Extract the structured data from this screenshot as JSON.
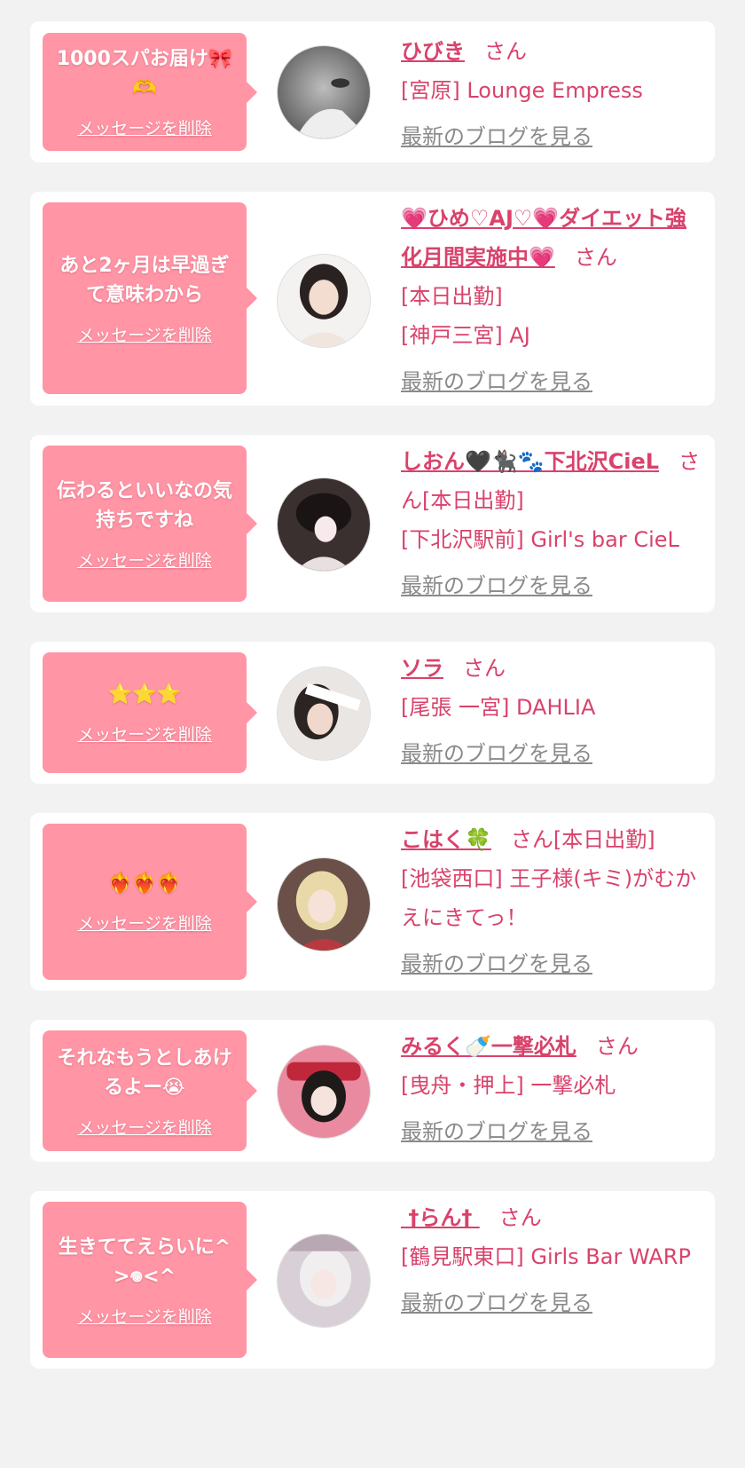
{
  "delete_label": "メッセージを削除",
  "blog_label": "最新のブログを見る",
  "san_label": "さん",
  "colors": {
    "background": "#f2f2f2",
    "bubble": "#ff95a5",
    "accent": "#d9426b",
    "link_gray": "#8a8a8a"
  },
  "cards": [
    {
      "message": "1000スパお届け🎀🫶",
      "cast_name": "ひびき",
      "suffix": "",
      "extra_lines": [
        "[宮原] Lounge Empress"
      ]
    },
    {
      "message": "あと2ヶ月は早過ぎて意味わから",
      "cast_name": "💗ひめ♡AJ♡💗ダイエット強化月間実施中💗",
      "suffix": "",
      "extra_lines": [
        "[本日出勤]",
        "[神戸三宮] AJ"
      ]
    },
    {
      "message": "伝わるといいなの気持ちですね",
      "cast_name": "しおん🖤🐈‍⬛🐾下北沢CieL",
      "suffix": "[本日出勤]",
      "extra_lines": [
        "[下北沢駅前] Girl's bar CieL"
      ]
    },
    {
      "message": "⭐⭐⭐",
      "cast_name": "ソラ",
      "suffix": "",
      "extra_lines": [
        "[尾張 一宮] DAHLIA"
      ]
    },
    {
      "message": "❤️‍🔥❤️‍🔥❤️‍🔥",
      "cast_name": "こはく🍀",
      "suffix": "[本日出勤]",
      "extra_lines": [
        "[池袋西口] 王子様(キミ)がむかえにきてっ！"
      ]
    },
    {
      "message": "それなもうとしあけるよー😭",
      "cast_name": "みるく🍼一撃必札",
      "suffix": "",
      "extra_lines": [
        "[曳舟・押上] 一撃必札"
      ]
    },
    {
      "message": "生きててえらいに^>𖦹<^",
      "cast_name": " †らん† ",
      "suffix": "",
      "extra_lines": [
        "[鶴見駅東口] Girls Bar WARP"
      ]
    }
  ]
}
